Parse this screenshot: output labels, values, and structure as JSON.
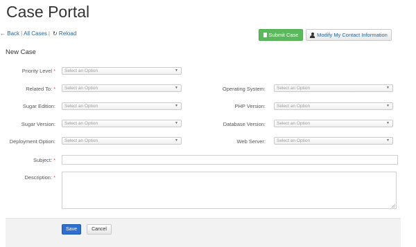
{
  "page": {
    "title": "Case Portal"
  },
  "nav": {
    "back_arrow": "←",
    "back": "Back",
    "sep": "|",
    "all_cases": "All Cases",
    "reload": "Reload",
    "reload_icon": "refresh-icon",
    "reload_glyph": "↻"
  },
  "actions": {
    "submit_label": "Submit Case",
    "submit_icon": "document-icon",
    "modify_label": "Modify My Contact Information",
    "modify_icon": "user-icon"
  },
  "form": {
    "section_title": "New Case",
    "required_marker": "*",
    "select_placeholder": "Select an Option",
    "caret": "▼",
    "fields": {
      "priority_level": "Priority Level",
      "related_to": "Related To:",
      "operating_system": "Operating System:",
      "sugar_edition": "Sugar Edition:",
      "php_version": "PHP Version:",
      "sugar_version": "Sugar Version:",
      "database_version": "Database Version:",
      "deployment_option": "Deployment Option:",
      "web_server": "Web Server:",
      "subject": "Subject:",
      "description": "Description:"
    }
  },
  "footer": {
    "save_label": "Save",
    "cancel_label": "Cancel"
  },
  "colors": {
    "primary": "#2f6fd0",
    "success": "#5cb85c",
    "required": "#d9534f",
    "link": "#2a6496"
  }
}
